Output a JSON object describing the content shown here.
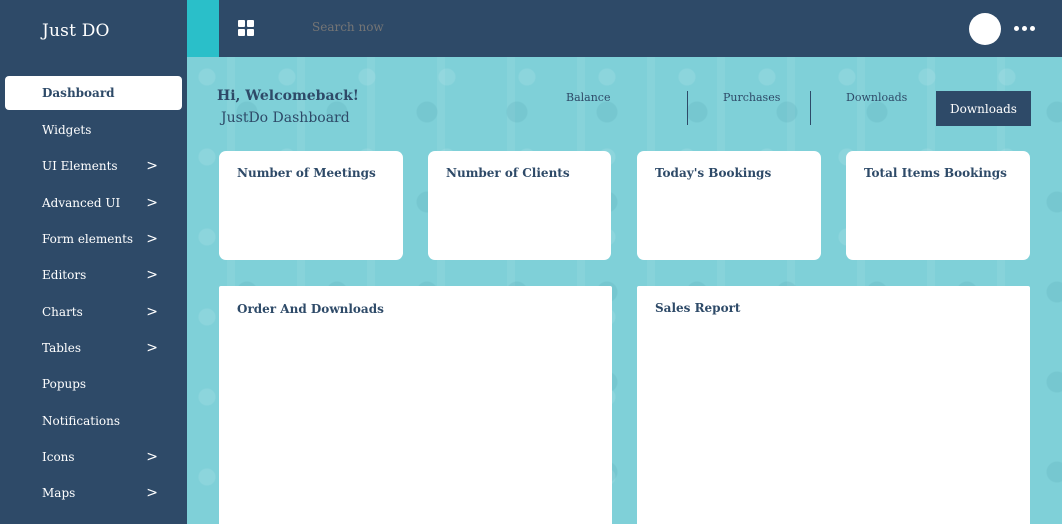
{
  "brand": "Just DO",
  "sidebar": {
    "items": [
      {
        "label": "Dashboard",
        "arrow": ""
      },
      {
        "label": "Widgets",
        "arrow": ""
      },
      {
        "label": "UI Elements",
        "arrow": ">"
      },
      {
        "label": "Advanced UI",
        "arrow": ">"
      },
      {
        "label": "Form elements",
        "arrow": ">"
      },
      {
        "label": "Editors",
        "arrow": ">"
      },
      {
        "label": "Charts",
        "arrow": ">"
      },
      {
        "label": "Tables",
        "arrow": ">"
      },
      {
        "label": "Popups",
        "arrow": ""
      },
      {
        "label": "Notifications",
        "arrow": ""
      },
      {
        "label": "Icons",
        "arrow": ">"
      },
      {
        "label": "Maps",
        "arrow": ">"
      }
    ]
  },
  "topbar": {
    "search_placeholder": "Search now",
    "menu_icon": "grid-icon",
    "more_icon": "more-horizontal-icon"
  },
  "header": {
    "greeting": "Hi, Welcomeback!",
    "subtitle": "JustDo Dashboard",
    "stats": [
      "Balance",
      "Purchases",
      "Downloads"
    ],
    "button_label": "Downloads"
  },
  "cards": {
    "meetings": "Number of Meetings",
    "clients": "Number of Clients",
    "bookings": "Today's Bookings",
    "total_items": "Total Items Bookings",
    "orders": "Order And Downloads",
    "sales": "Sales Report"
  },
  "colors": {
    "sidebar_bg": "#2e4a68",
    "accent_teal": "#2abfc9",
    "main_bg": "#7fd0d8"
  }
}
